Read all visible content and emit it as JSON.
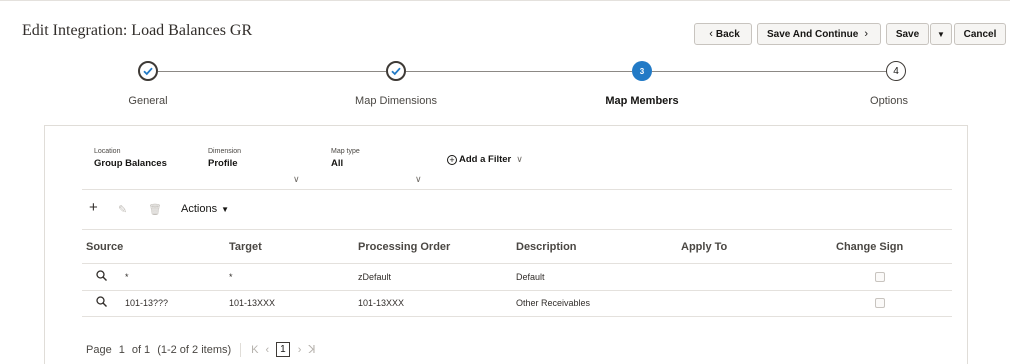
{
  "header": {
    "title": "Edit Integration: Load Balances GR",
    "back_label": "Back",
    "save_continue_label": "Save And Continue",
    "save_label": "Save",
    "cancel_label": "Cancel"
  },
  "train": {
    "steps": [
      {
        "label": "General",
        "state": "done"
      },
      {
        "label": "Map Dimensions",
        "state": "done"
      },
      {
        "label": "Map Members",
        "state": "current",
        "number": "3"
      },
      {
        "label": "Options",
        "state": "future",
        "number": "4"
      }
    ]
  },
  "filters": {
    "location": {
      "label": "Location",
      "value": "Group Balances"
    },
    "dimension": {
      "label": "Dimension",
      "value": "Profile"
    },
    "map_type": {
      "label": "Map type",
      "value": "All"
    },
    "add_filter_label": "Add a Filter"
  },
  "toolbar": {
    "actions_label": "Actions"
  },
  "table": {
    "columns": [
      "Source",
      "Target",
      "Processing Order",
      "Description",
      "Apply To",
      "Change Sign"
    ],
    "rows": [
      {
        "source": "*",
        "target": "*",
        "processing_order": "zDefault",
        "description": "Default",
        "apply_to": "",
        "change_sign": false
      },
      {
        "source": "101-13???",
        "target": "101-13XXX",
        "processing_order": "101-13XXX",
        "description": "Other Receivables",
        "apply_to": "",
        "change_sign": false
      }
    ]
  },
  "pager": {
    "page_label": "Page",
    "current_page": "1",
    "of_label": "of 1",
    "items_label": "(1-2 of 2 items)",
    "box_page": "1"
  },
  "colors": {
    "accent": "#227ac6",
    "text": "#161513",
    "border": "#e0ddd8"
  }
}
